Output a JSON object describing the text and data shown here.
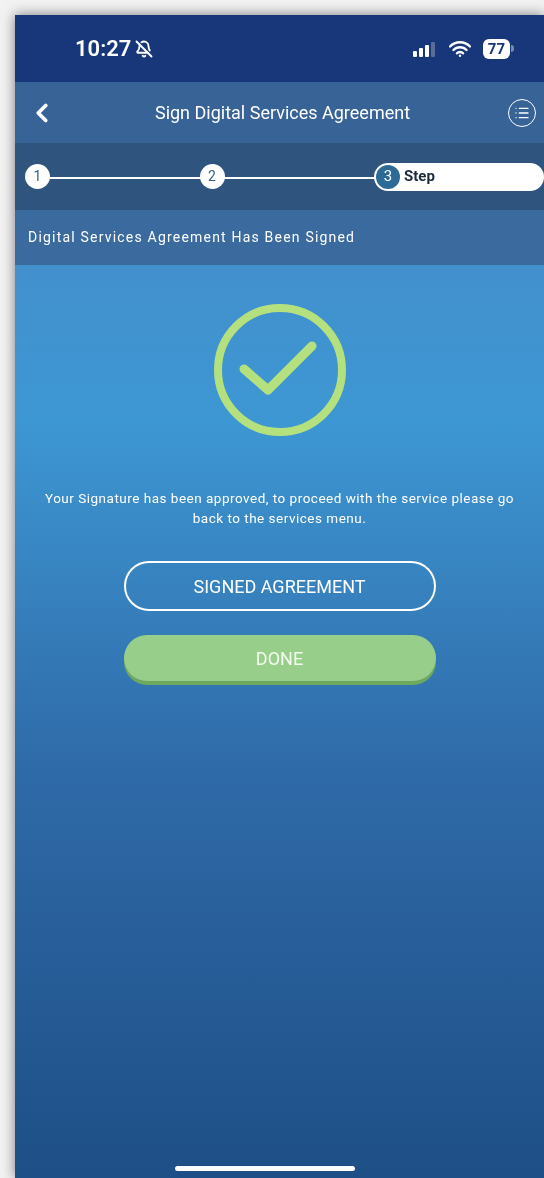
{
  "status_bar": {
    "time": "10:27",
    "silent": true,
    "battery": "77"
  },
  "header": {
    "title": "Sign Digital Services Agreement"
  },
  "steps": [
    {
      "number": "1",
      "selected": false
    },
    {
      "number": "2",
      "selected": false
    },
    {
      "number": "3",
      "selected": true,
      "label": "Step"
    }
  ],
  "subtitle": "Digital Services Agreement Has Been Signed",
  "message": "Your Signature has been approved, to proceed with the service please go back to the services menu.",
  "buttons": [
    {
      "label": "SIGNED AGREEMENT",
      "kind": "outline"
    },
    {
      "label": "DONE",
      "kind": "filled"
    }
  ]
}
